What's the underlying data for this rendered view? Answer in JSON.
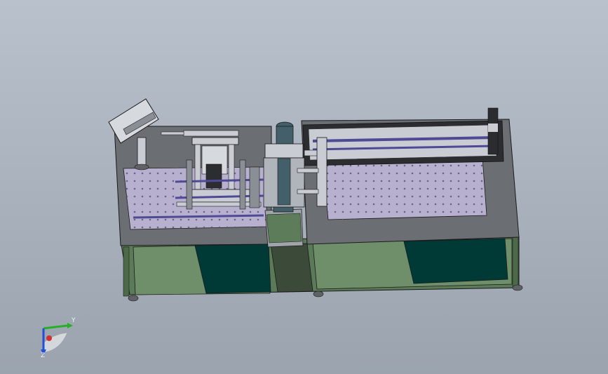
{
  "viewport": {
    "background_top": "#b9c1cc",
    "background_bottom": "#9aa3ae"
  },
  "model": {
    "colors": {
      "frame_green": "#5b7a57",
      "panel_dark": "#003a36",
      "deck_gray": "#6b6e72",
      "plate_lavender": "#b8b0cf",
      "rail_blue": "#4e4a95",
      "steel": "#c9cdd3",
      "cylinder": "#43606a"
    }
  },
  "triad": {
    "y_label": "Y",
    "z_label": "Z",
    "y_color": "#26b026",
    "z_color": "#2050d8",
    "x_color": "#d03030"
  }
}
